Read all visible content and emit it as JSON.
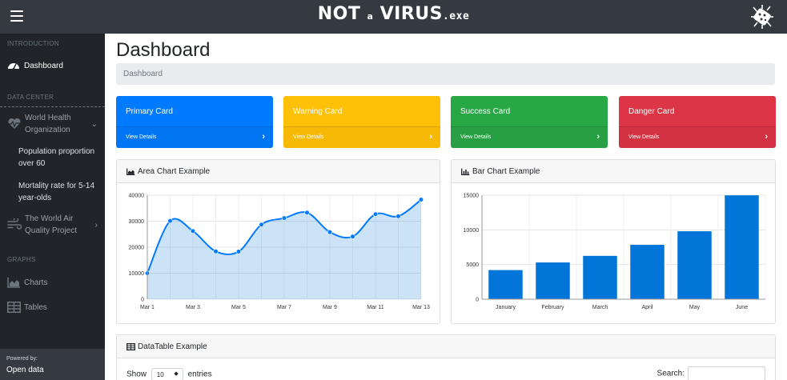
{
  "topbar": {
    "brand_main": "NOT",
    "brand_small": "a",
    "brand_word": "VIRUS",
    "brand_ext": ".exe",
    "menu_icon": "hamburger-icon",
    "logo_icon": "virus-logo-icon"
  },
  "sidebar": {
    "sections": {
      "introduction": "INTRODUCTION",
      "data_center": "DATA CENTER",
      "graphs": "GRAPHS"
    },
    "items": {
      "dashboard": "Dashboard",
      "who_line1": "World Health",
      "who_line2": "Organization",
      "pop_line1": "Population proportion",
      "pop_line2": "over 60",
      "mort_line1": "Mortality rate for 5-14",
      "mort_line2": "year-olds",
      "air_line1": "The World Air",
      "air_line2": "Quality Project",
      "charts": "Charts",
      "tables": "Tables"
    },
    "footer": {
      "powered": "Powered by:",
      "source": "Open data"
    }
  },
  "main": {
    "title": "Dashboard",
    "breadcrumb": "Dashboard",
    "cards": [
      {
        "title": "Primary Card",
        "link": "View Details",
        "color": "#007bff"
      },
      {
        "title": "Warning Card",
        "link": "View Details",
        "color": "#ffc107"
      },
      {
        "title": "Success Card",
        "link": "View Details",
        "color": "#28a745"
      },
      {
        "title": "Danger Card",
        "link": "View Details",
        "color": "#dc3545"
      }
    ],
    "area_panel_title": "Area Chart Example",
    "bar_panel_title": "Bar Chart Example",
    "table_panel_title": "DataTable Example",
    "table": {
      "show": "Show",
      "entries_value": "10",
      "entries": "entries",
      "search": "Search:"
    }
  },
  "chart_data": [
    {
      "type": "area",
      "x": [
        "Mar 1",
        "Mar 2",
        "Mar 3",
        "Mar 4",
        "Mar 5",
        "Mar 6",
        "Mar 7",
        "Mar 8",
        "Mar 9",
        "Mar 10",
        "Mar 11",
        "Mar 12",
        "Mar 13"
      ],
      "x_tick_labels": [
        "Mar 1",
        "Mar 3",
        "Mar 5",
        "Mar 7",
        "Mar 9",
        "Mar 11",
        "Mar 13"
      ],
      "values": [
        10000,
        30100,
        26200,
        18400,
        18300,
        28700,
        31200,
        33300,
        25800,
        24100,
        32700,
        31900,
        38300
      ],
      "ylim": [
        0,
        40000
      ],
      "y_ticks": [
        0,
        10000,
        20000,
        30000,
        40000
      ],
      "grid": true,
      "color": "#007bff",
      "fill": "rgba(2,117,216,0.2)"
    },
    {
      "type": "bar",
      "categories": [
        "January",
        "February",
        "March",
        "April",
        "May",
        "June"
      ],
      "values": [
        4200,
        5300,
        6250,
        7850,
        9800,
        14980
      ],
      "ylim": [
        0,
        15000
      ],
      "y_ticks": [
        0,
        5000,
        10000,
        15000
      ],
      "grid": true,
      "color": "#0275d8"
    }
  ]
}
